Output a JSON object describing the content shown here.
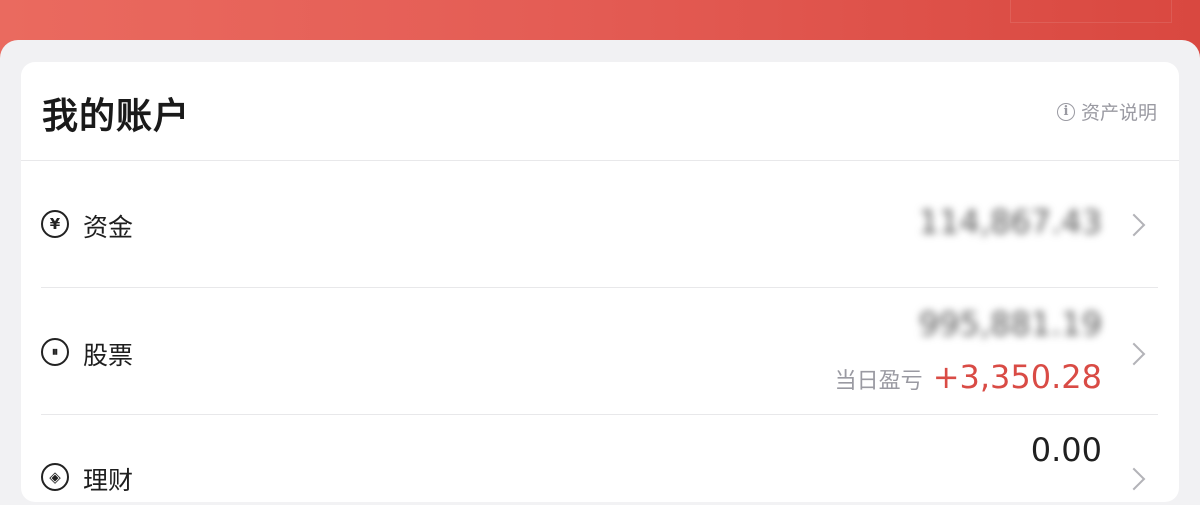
{
  "header": {
    "title": "我的账户",
    "explain_label": "资产说明",
    "explain_icon": "info-icon"
  },
  "rows": [
    {
      "label": "资金",
      "icon": "yuan-icon",
      "icon_glyph": "¥",
      "amount": "114,867.43"
    },
    {
      "label": "股票",
      "icon": "stock-icon",
      "icon_glyph": "◍",
      "amount": "995,881.19",
      "pnl_label": "当日盈亏",
      "pnl_value": "+3,350.28"
    },
    {
      "label": "理财",
      "icon": "wealth-icon",
      "icon_glyph": "◈",
      "amount": "0.00"
    }
  ],
  "colors": {
    "accent": "#e45d55",
    "profit": "#d94b45"
  }
}
